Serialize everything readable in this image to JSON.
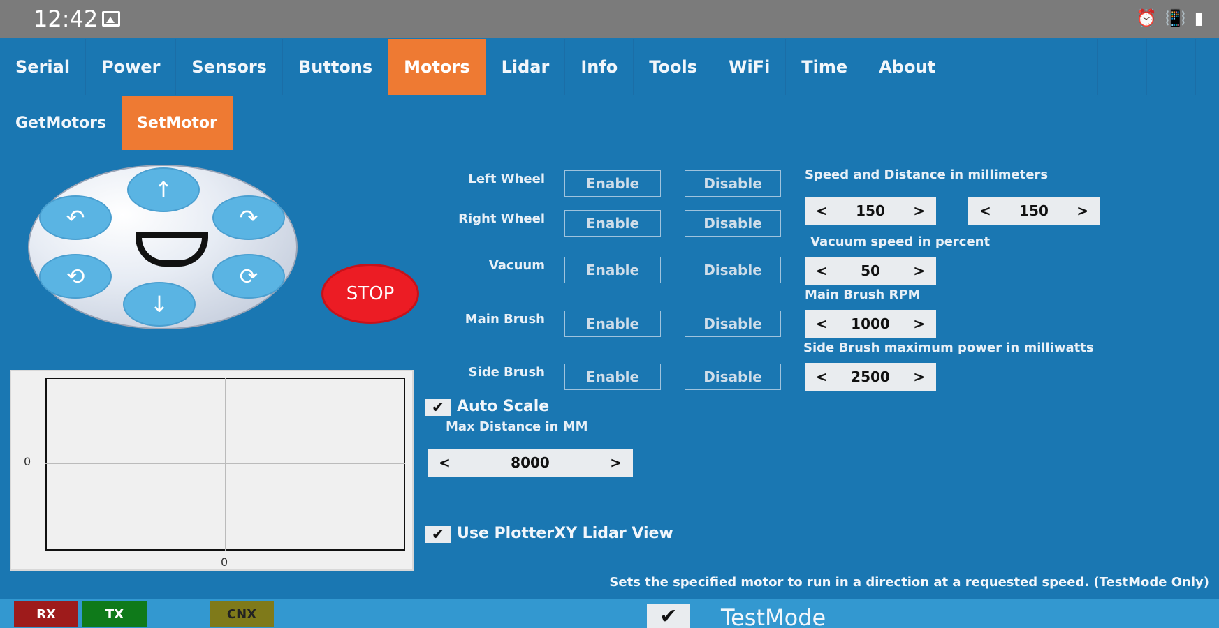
{
  "status_bar": {
    "time": "12:42",
    "icons": [
      "image-icon",
      "alarm-icon",
      "vibrate-icon",
      "battery-icon"
    ]
  },
  "tabs": [
    {
      "label": "Serial",
      "active": false
    },
    {
      "label": "Power",
      "active": false
    },
    {
      "label": "Sensors",
      "active": false
    },
    {
      "label": "Buttons",
      "active": false
    },
    {
      "label": "Motors",
      "active": true
    },
    {
      "label": "Lidar",
      "active": false
    },
    {
      "label": "Info",
      "active": false
    },
    {
      "label": "Tools",
      "active": false
    },
    {
      "label": "WiFi",
      "active": false
    },
    {
      "label": "Time",
      "active": false
    },
    {
      "label": "About",
      "active": false
    }
  ],
  "subtabs": [
    {
      "label": "GetMotors",
      "active": false
    },
    {
      "label": "SetMotor",
      "active": true
    }
  ],
  "joystick": {
    "up": "↑",
    "down": "↓",
    "rotate_left": "↶",
    "rotate_right": "↷",
    "spin_ccw": "⟲",
    "spin_cw": "⟳"
  },
  "stop_label": "STOP",
  "motors": [
    {
      "label": "Left Wheel",
      "enable": "Enable",
      "disable": "Disable"
    },
    {
      "label": "Right Wheel",
      "enable": "Enable",
      "disable": "Disable"
    },
    {
      "label": "Vacuum",
      "enable": "Enable",
      "disable": "Disable"
    },
    {
      "label": "Main Brush",
      "enable": "Enable",
      "disable": "Disable"
    },
    {
      "label": "Side Brush",
      "enable": "Enable",
      "disable": "Disable"
    }
  ],
  "settings": {
    "speed_distance_label": "Speed and Distance in millimeters",
    "speed_value": "150",
    "distance_value": "150",
    "vacuum_label": "Vacuum speed in percent",
    "vacuum_value": "50",
    "main_brush_label": "Main Brush RPM",
    "main_brush_value": "1000",
    "side_brush_label": "Side Brush maximum power in milliwatts",
    "side_brush_value": "2500",
    "prev": "<",
    "next": ">"
  },
  "auto_scale": {
    "label": "Auto Scale",
    "checked": true,
    "check": "✔"
  },
  "max_distance": {
    "label": "Max Distance in MM",
    "value": "8000"
  },
  "plotter": {
    "label": "Use PlotterXY Lidar View",
    "checked": true,
    "check": "✔",
    "x_zero": "0",
    "y_zero": "0"
  },
  "hint": "Sets the specified motor to run in a direction at a requested speed. (TestMode Only)",
  "indicators": [
    {
      "label": "RX",
      "color": "#9e1b1b"
    },
    {
      "label": "TX",
      "color": "#0f7a1a"
    },
    {
      "label": "CNX",
      "color": "#7f7a1a"
    }
  ],
  "testmode": {
    "label": "TestMode",
    "checked": true,
    "check": "✔"
  }
}
